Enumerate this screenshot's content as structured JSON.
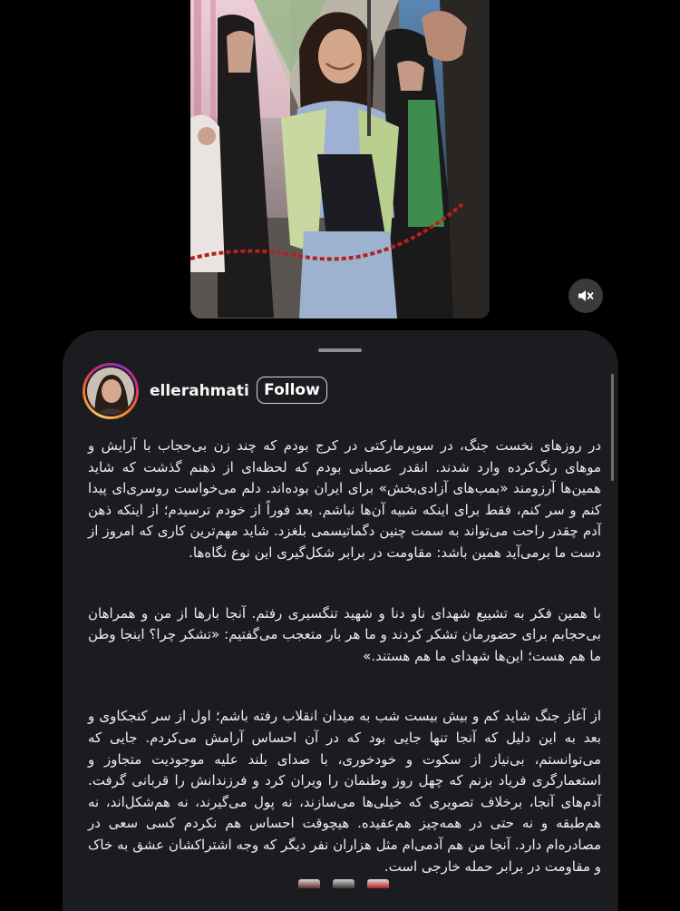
{
  "post": {
    "media": {
      "type": "photo",
      "muted": true,
      "mute_icon": "speaker-muted-icon"
    },
    "username": "ellerahmati",
    "follow_label": "Follow",
    "caption": [
      "در روزهای نخست جنگ، در سوپرمارکتی در کرج بودم که چند زن بی‌حجاب با آرایش و موهای رنگ‌کرده وارد شدند. انقدر عصبانی بودم که لحظه‌ای از ذهنم گذشت که شاید همین‌ها آرزومند «بمب‌های آزادی‌بخش» برای ایران بوده‌اند. دلم می‌خواست روسری‌ای پیدا کنم و سر کنم، فقط برای اینکه شبیه آن‌ها نباشم. بعد فوراً از خودم ترسیدم؛ از اینکه ذهن آدم چقدر راحت می‌تواند به سمت چنین دگماتیسمی بلغزد. شاید مهم‌ترین کاری که امروز از دست ما برمی‌آید همین باشد: مقاومت در برابر شکل‌گیری این نوع نگاه‌ها.",
      "با همین فکر به تشییع شهدای ناو دنا و شهید تنگسیری رفتم. آنجا بارها از من و همراهان بی‌حجابم برای حضورمان تشکر کردند و ما هر بار متعجب می‌گفتیم: «تشکر چرا؟ اینجا وطن ما هم هست؛ این‌ها شهدای ما هم هستند.»",
      "از آغاز جنگ شاید کم و بیش بیست شب به میدان انقلاب رفته باشم؛ اول از سر کنجکاوی و بعد به این دلیل که آنجا تنها جایی بود که در آن احساس آرامش می‌کردم. جایی که می‌توانستم، بی‌نیاز از سکوت و خودخوری، با صدای بلند علیه موجودیت متجاوز و استعمارگری فریاد بزنم که چهل روز وطنمان را ویران کرد و فرزندانش را قربانی گرفت. آدم‌های آنجا، برخلاف تصویری که خیلی‌ها می‌سازند، نه پول می‌گیرند، نه هم‌شکل‌اند، نه هم‌طبقه و نه حتی در همه‌چیز هم‌عقیده. هیچوقت احساس هم نکردم کسی سعی در مصادره‌ام دارد. آنجا من هم آدمی‌ام مثل هزاران نفر دیگر که وجه اشتراکشان عشق به خاک و مقاومت در برابر حمله خارجی است."
    ],
    "colors": {
      "sheet_bg": "#1b1c1f",
      "text": "#eeeeee",
      "ring": [
        "#fdc468",
        "#fa7e1e",
        "#d62976",
        "#962fbf"
      ]
    }
  }
}
